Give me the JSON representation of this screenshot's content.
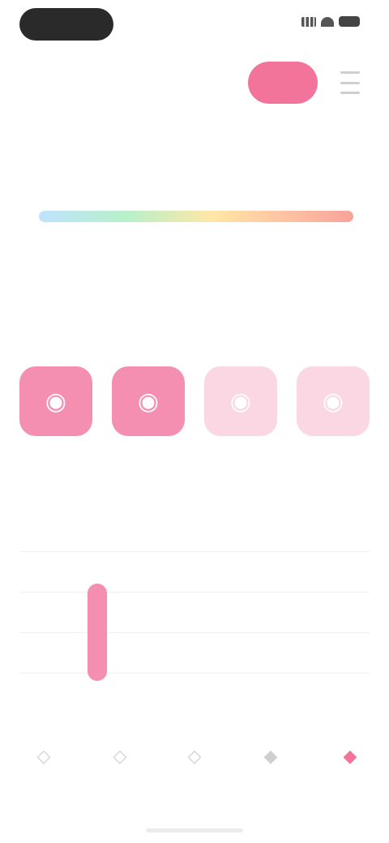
{
  "status_bar": {
    "time": "",
    "icons": [
      "signal-icon",
      "wifi-icon",
      "battery-icon"
    ]
  },
  "header": {
    "title": "",
    "pill_label": "",
    "menu_icon": "menu-icon"
  },
  "summary": {
    "value": "",
    "unit": "",
    "scale_labels": [
      "",
      "",
      "",
      ""
    ],
    "note": ""
  },
  "sections": {
    "cards_title": "",
    "chart_title": ""
  },
  "cards": [
    {
      "label": "",
      "icon": "card-icon",
      "state": "on"
    },
    {
      "label": "",
      "icon": "card-icon",
      "state": "on"
    },
    {
      "label": "",
      "icon": "card-icon",
      "state": "off"
    },
    {
      "label": "",
      "icon": "card-icon",
      "state": "off"
    }
  ],
  "chart_data": {
    "type": "bar",
    "categories": [
      "",
      "",
      ""
    ],
    "values": [
      0.8,
      0,
      0
    ],
    "title": "",
    "xlabel": "",
    "ylabel": "",
    "ylim": [
      0,
      1
    ]
  },
  "tabbar": [
    {
      "label": "",
      "icon": "tab-icon-1",
      "active": false
    },
    {
      "label": "",
      "icon": "tab-icon-2",
      "active": false
    },
    {
      "label": "",
      "icon": "tab-icon-3",
      "active": false
    },
    {
      "label": "",
      "icon": "tab-icon-4",
      "active": false
    },
    {
      "label": "",
      "icon": "tab-icon-5",
      "active": true
    }
  ],
  "colors": {
    "accent": "#f2749a",
    "accent_light": "#fbd7e4",
    "bar": "#f48fb1"
  }
}
